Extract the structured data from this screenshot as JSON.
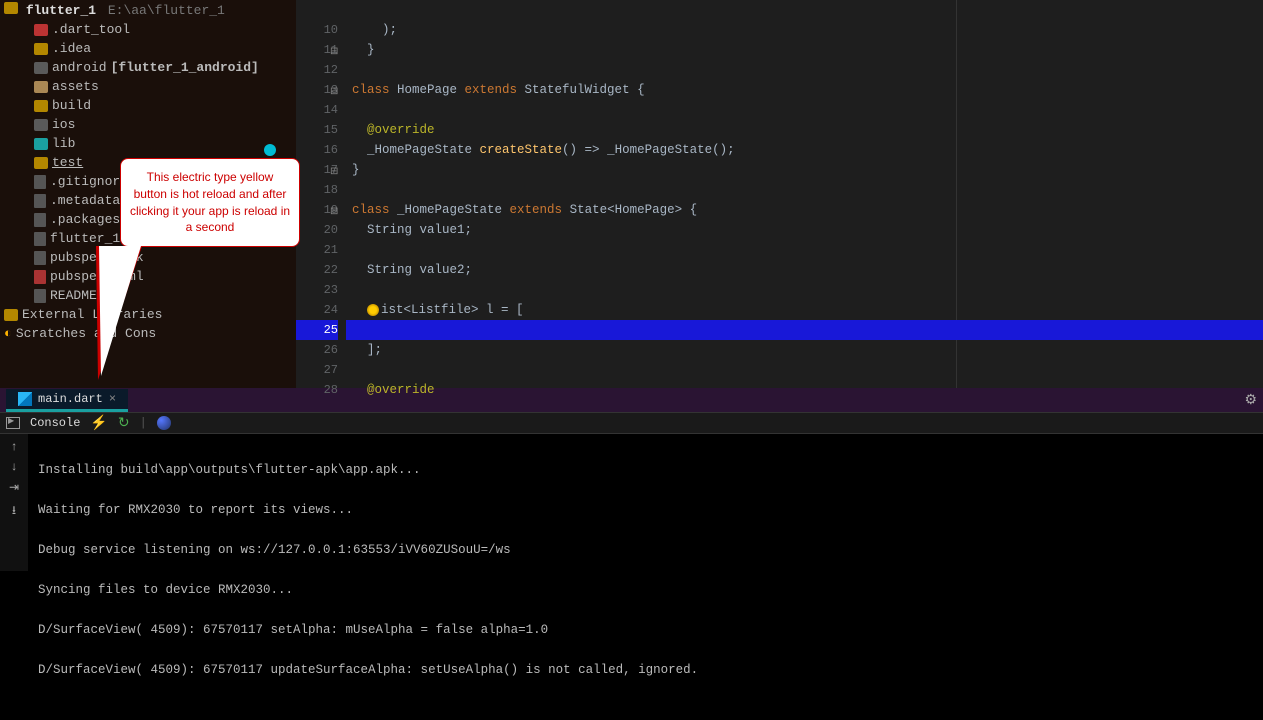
{
  "project": {
    "name": "flutter_1",
    "path": "E:\\aa\\flutter_1",
    "tree": [
      {
        "label": ".dart_tool",
        "icon": "folder-red",
        "nested": true
      },
      {
        "label": ".idea",
        "icon": "folder-yel",
        "nested": true
      },
      {
        "label_plain": "android ",
        "label_bold": "[flutter_1_android]",
        "icon": "folder-gray",
        "nested": true
      },
      {
        "label": "assets",
        "icon": "folder-tan",
        "nested": true
      },
      {
        "label": "build",
        "icon": "folder-yel",
        "nested": true
      },
      {
        "label": "ios",
        "icon": "folder-gray",
        "nested": true
      },
      {
        "label": "lib",
        "icon": "folder-teal",
        "nested": true
      },
      {
        "label": "test",
        "icon": "folder-yel",
        "underline": true,
        "nested": true
      },
      {
        "label": ".gitignore",
        "icon": "file",
        "nested": true
      },
      {
        "label": ".metadata",
        "icon": "file",
        "nested": true
      },
      {
        "label": ".packages",
        "icon": "file",
        "nested": true
      },
      {
        "label": "flutter_1.iml",
        "icon": "file",
        "nested": true
      },
      {
        "label": "pubspec.lock",
        "icon": "file",
        "nested": true
      },
      {
        "label": "pubspec.yaml",
        "icon": "file-yml",
        "nested": true
      },
      {
        "label": "README.md",
        "icon": "file",
        "nested": true
      }
    ],
    "ext_lib": "External Libraries",
    "scratches": "Scratches and Cons"
  },
  "editor": {
    "lines": {
      "l10": "10",
      "l11": "11",
      "l12": "12",
      "l13": "13",
      "l14": "14",
      "l15": "15",
      "l16": "16",
      "l17": "17",
      "l18": "18",
      "l19": "19",
      "l20": "20",
      "l21": "21",
      "l22": "22",
      "l23": "23",
      "l24": "24",
      "l25": "25",
      "l26": "26",
      "l27": "27",
      "l28": "28"
    },
    "code": {
      "c10": "    );",
      "c11": "  }",
      "c12": "",
      "c13a": "class ",
      "c13b": "HomePage ",
      "c13c": "extends ",
      "c13d": "StatefulWidget {",
      "c14": "",
      "c15": "  @override",
      "c16a": "  _HomePageState ",
      "c16b": "createState",
      "c16c": "() => ",
      "c16d": "_HomePageState",
      "c16e": "();",
      "c17": "}",
      "c18": "",
      "c19a": "class ",
      "c19b": "_HomePageState ",
      "c19c": "extends ",
      "c19d": "State<",
      "c19e": "HomePage",
      "c19f": "> {",
      "c20a": "  String ",
      "c20b": "value1;",
      "c21": "",
      "c22a": "  String ",
      "c22b": "value2;",
      "c23": "",
      "c24a": "ist<",
      "c24b": "Listfile",
      "c24c": "> l = [",
      "c25": "",
      "c26": "  ];",
      "c27": "",
      "c28": "  @override"
    }
  },
  "tab": {
    "file": "main.dart"
  },
  "consolebar": {
    "label": "Console"
  },
  "console": {
    "l1": "Installing build\\app\\outputs\\flutter-apk\\app.apk...",
    "l2": "Waiting for RMX2030 to report its views...",
    "l3": "Debug service listening on ws://127.0.0.1:63553/iVV60ZUSouU=/ws",
    "l4": "Syncing files to device RMX2030...",
    "l5": "D/SurfaceView( 4509): 67570117 setAlpha: mUseAlpha = false alpha=1.0",
    "l6": "D/SurfaceView( 4509): 67570117 updateSurfaceAlpha: setUseAlpha() is not called, ignored."
  },
  "callout": {
    "text": "This electric type yellow button is hot reload and after clicking it your app is reload in a second"
  }
}
